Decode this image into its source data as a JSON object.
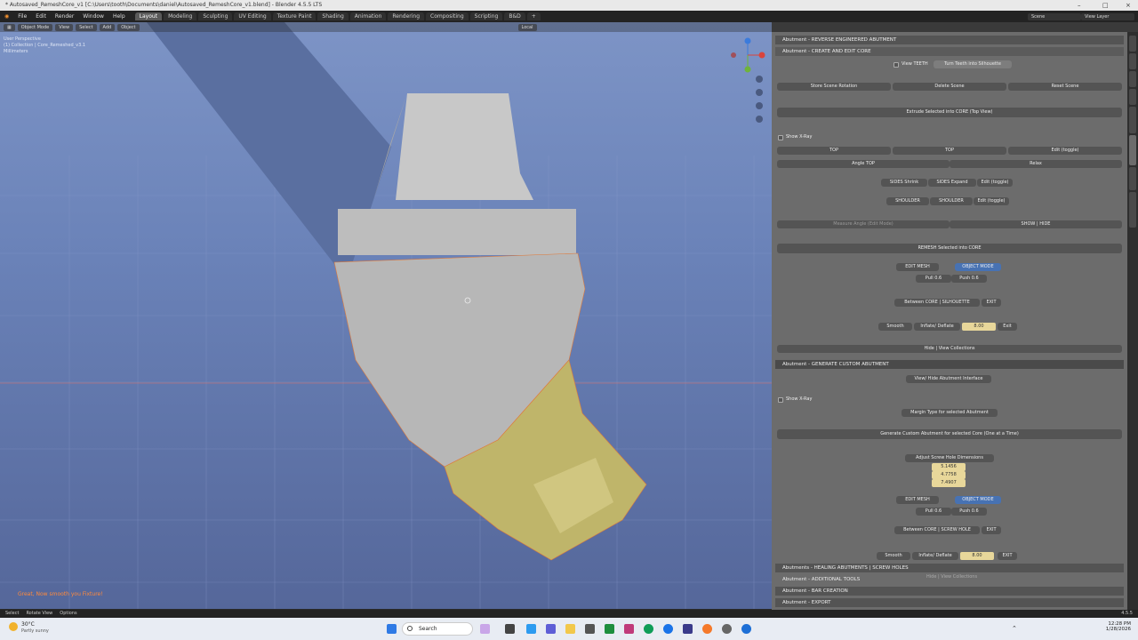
{
  "window": {
    "title": "* Autosaved_RemeshCore_v1 [C:\\Users\\tooth\\Documents\\daniel\\Autosaved_RemeshCore_v1.blend] - Blender 4.5.5 LTS"
  },
  "menu": {
    "items": [
      "File",
      "Edit",
      "Render",
      "Window",
      "Help"
    ],
    "workspaces": [
      "Layout",
      "Modeling",
      "Sculpting",
      "UV Editing",
      "Texture Paint",
      "Shading",
      "Animation",
      "Rendering",
      "Compositing",
      "Scripting",
      "B&D"
    ],
    "active_workspace": "Layout",
    "scene": "Scene",
    "view_layer": "View Layer"
  },
  "viewport_header": {
    "mode": "Object Mode",
    "menus": [
      "View",
      "Select",
      "Add",
      "Object"
    ],
    "transform": "Local"
  },
  "viewport": {
    "info_lines": [
      "User Perspective",
      "(1) Collection | Core_Remeshed_v3.1",
      "Millimeters"
    ],
    "message": "Great, Now smooth you Fixture!"
  },
  "panel": {
    "sections": {
      "reverse": "Abutment - REVERSE ENGINEERED ABUTMENT",
      "create": "Abutment - CREATE AND EDIT CORE",
      "generate": "Abutment - GENERATE CUSTOM ABUTMENT",
      "healing": "Abutments - HEALING ABUTMENTS | SCREW HOLES",
      "tools": "Abutment - ADDITIONAL TOOLS",
      "bar": "Abutment - BAR CREATION",
      "export": "Abutment - EXPORT"
    },
    "view_teeth": "View TEETH",
    "turn_teeth": "Turn Teeth into Silhouette",
    "store_rotation": "Store Scene Rotation",
    "delete_scene": "Delete Scene",
    "reset_scene": "Reset Scene",
    "extrude": "Extrude Selected into CORE (Top View)",
    "show_xray": "Show X-Ray",
    "top1": "TOP",
    "top2": "TOP",
    "edit_toggle": "Edit (toggle)",
    "angle_top": "Angle TOP",
    "relax": "Relax",
    "sides_shrink": "SIDES Shrink",
    "sides_expand": "SIDES Expand",
    "edit_toggle2": "Edit (toggle)",
    "shoulder1": "SHOULDER",
    "shoulder2": "SHOULDER",
    "edit_toggle3": "Edit (toggle)",
    "measure_angle": "Measure Angle (Edit Mode)",
    "show_hide": "SHOW | HIDE",
    "remesh": "REMESH Selected into CORE",
    "edit_mesh": "EDIT MESH",
    "object_mode": "OBJECT MODE",
    "pull": "Pull 0.6",
    "push": "Push 0.6",
    "between_core": "Between CORE | SILHOUETTE",
    "exit": "EXIT",
    "smooth": "Smooth",
    "inflate": "Inflate/ Deflate",
    "inflate_val": "8.00",
    "exit2": "Exit",
    "hide_collections": "Hide | View Collections",
    "view_hide_interface": "View/ Hide Abutment Interface",
    "show_xray2": "Show X-Ray",
    "margin_type": "Margin Type for selected Abutment",
    "generate_btn": "Generate Custom Abutment for selected Core (One at a Time)",
    "adjust_screw": "Adjust Screw Hole Dimensions",
    "screw_vals": [
      "5.1456",
      "4.7758",
      "7.4907"
    ],
    "edit_mesh2": "EDIT MESH",
    "object_mode2": "OBJECT MODE",
    "pull2": "Pull 0.6",
    "push2": "Push 0.6",
    "between_core2": "Between CORE | SCREW HOLE",
    "exit3": "EXIT",
    "smooth2": "Smooth",
    "inflate2": "Inflate/ Deflate",
    "inflate_val2": "8.00",
    "exit4": "EXIT",
    "hide_collections2": "Hide | View Collections"
  },
  "statusbar": {
    "items": [
      "Select",
      "Rotate View",
      "Options"
    ],
    "version": "4.5.5"
  },
  "taskbar": {
    "weather_temp": "30°C",
    "weather_desc": "Partly sunny",
    "search": "Search",
    "time": "12:28 PM",
    "date": "1/28/2026"
  }
}
